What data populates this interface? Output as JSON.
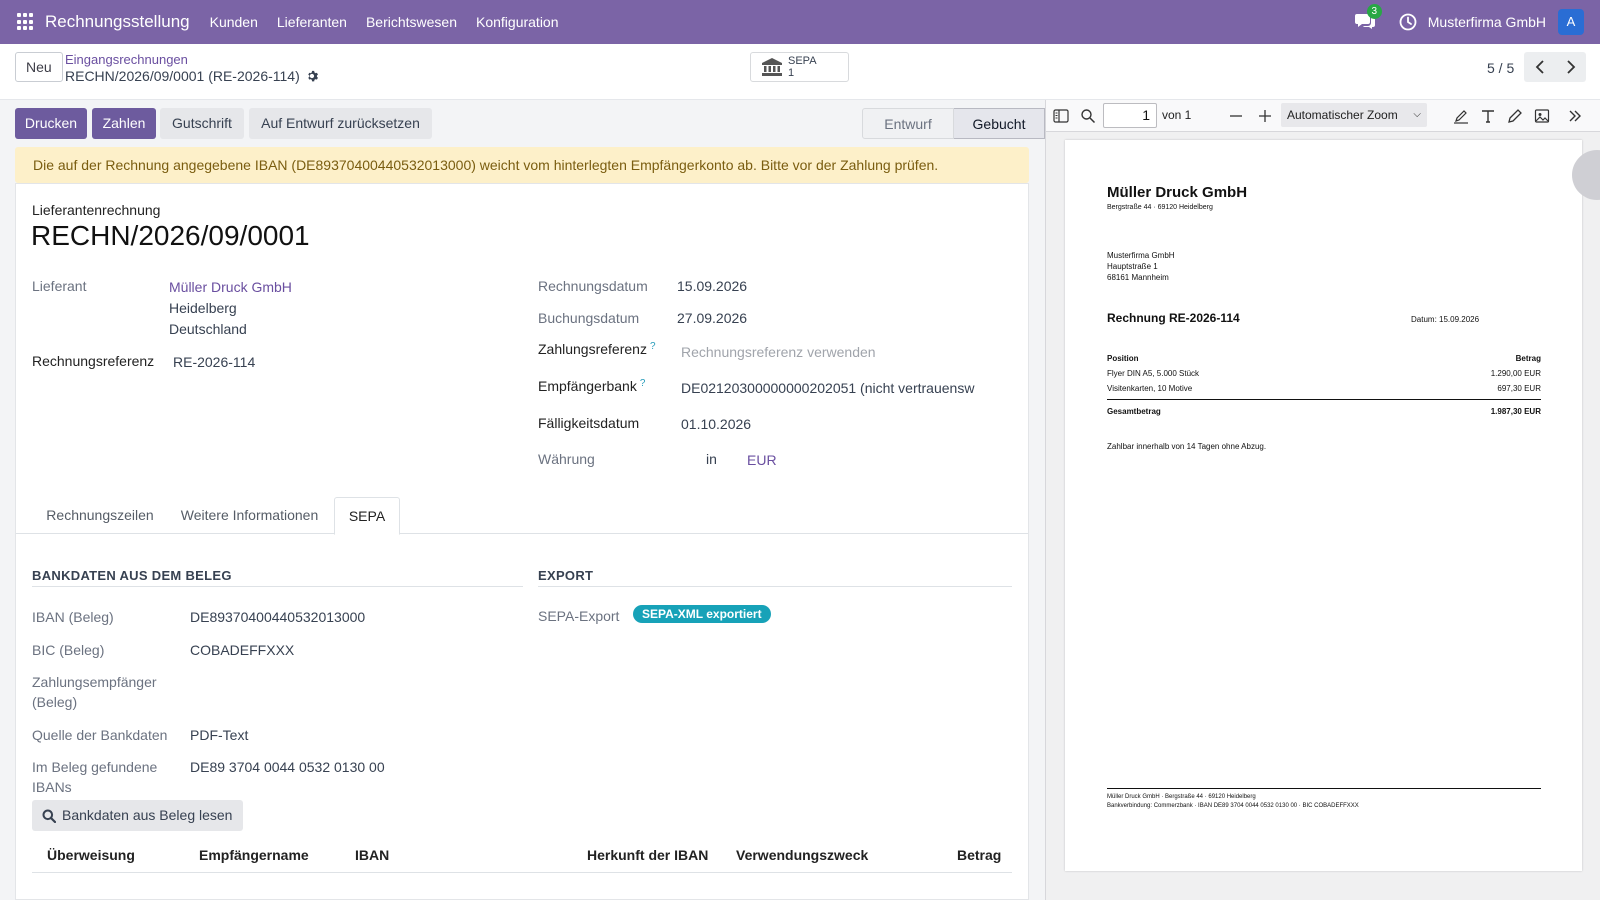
{
  "topnav": {
    "app_title": "Rechnungsstellung",
    "menu": [
      "Kunden",
      "Lieferanten",
      "Berichtswesen",
      "Konfiguration"
    ],
    "chat_count": "3",
    "company": "Musterfirma GmbH",
    "avatar_letter": "A",
    "bg_color": "#7b64a6"
  },
  "control_panel": {
    "new_button": "Neu",
    "breadcrumb": "Eingangsrechnungen",
    "record_name": "RECHN/2026/09/0001 (RE-2026-114)",
    "smart_button": {
      "label": "SEPA",
      "count": "1",
      "icon": "bank-icon"
    },
    "pager": "5 / 5"
  },
  "actions": {
    "print": "Drucken",
    "pay": "Zahlen",
    "credit_note": "Gutschrift",
    "reset": "Auf Entwurf zurücksetzen"
  },
  "statusbar": {
    "draft": "Entwurf",
    "posted": "Gebucht"
  },
  "alert": "Die auf der Rechnung angegebene IBAN (DE89370400440532013000) weicht vom hinterlegten Empfängerkonto ab. Bitte vor der Zahlung prüfen.",
  "form": {
    "doc_type": "Lieferantenrechnung",
    "number": "RECHN/2026/09/0001",
    "vendor_label": "Lieferant",
    "vendor_name": "Müller Druck GmbH",
    "vendor_city": "Heidelberg",
    "vendor_country": "Deutschland",
    "bill_ref_label": "Rechnungsreferenz",
    "bill_ref": "RE-2026-114",
    "invoice_date_label": "Rechnungsdatum",
    "invoice_date": "15.09.2026",
    "accounting_date_label": "Buchungsdatum",
    "accounting_date": "27.09.2026",
    "payment_ref_label": "Zahlungsreferenz",
    "payment_ref_placeholder": "Rechnungsreferenz verwenden",
    "recipient_bank_label": "Empfängerbank",
    "recipient_bank": "DE02120300000000202051 (nicht vertrauensw",
    "due_date_label": "Fälligkeitsdatum",
    "due_date": "01.10.2026",
    "currency_label": "Währung",
    "currency_in": "in",
    "currency": "EUR",
    "help_mark": "?"
  },
  "tabs": [
    "Rechnungszeilen",
    "Weitere Informationen",
    "SEPA"
  ],
  "sepa_tab": {
    "bank_section": "BANKDATEN AUS DEM BELEG",
    "export_section": "EXPORT",
    "iban_label": "IBAN (Beleg)",
    "iban": "DE89370400440532013000",
    "bic_label": "BIC (Beleg)",
    "bic": "COBADEFFXXX",
    "payee_label_1": "Zahlungsempfänger",
    "payee_label_2": "(Beleg)",
    "source_label": "Quelle der Bankdaten",
    "source": "PDF-Text",
    "found_ibans_label_1": "Im Beleg gefundene",
    "found_ibans_label_2": "IBANs",
    "found_ibans": "DE89 3704 0044 0532 0130 00",
    "sepa_export_label": "SEPA-Export",
    "sepa_export_badge": "SEPA-XML exportiert",
    "read_button": "Bankdaten aus Beleg lesen",
    "table_headers": [
      "Überweisung",
      "Empfängername",
      "IBAN",
      "Herkunft der IBAN",
      "Verwendungszweck",
      "Betrag"
    ]
  },
  "pdf_viewer": {
    "page_number": "1",
    "page_of": "von 1",
    "zoom": "Automatischer Zoom",
    "doc": {
      "sender_name": "Müller Druck GmbH",
      "sender_address": "Bergstraße 44 · 69120 Heidelberg",
      "recipient_lines": [
        "Musterfirma GmbH",
        "Hauptstraße 1",
        "68161 Mannheim"
      ],
      "title": "Rechnung RE-2026-114",
      "date": "Datum: 15.09.2026",
      "col_position": "Position",
      "col_amount": "Betrag",
      "items": [
        {
          "desc": "Flyer DIN A5, 5.000 Stück",
          "amount": "1.290,00 EUR"
        },
        {
          "desc": "Visitenkarten, 10 Motive",
          "amount": "697,30 EUR"
        }
      ],
      "total_label": "Gesamtbetrag",
      "total": "1.987,30 EUR",
      "terms": "Zahlbar innerhalb von 14 Tagen ohne Abzug.",
      "footer_1": "Müller Druck GmbH · Bergstraße 44 · 69120 Heidelberg",
      "footer_2": "Bankverbindung: Commerzbank · IBAN DE89 3704 0044 0532 0130 00 · BIC COBADEFFXXX"
    }
  }
}
